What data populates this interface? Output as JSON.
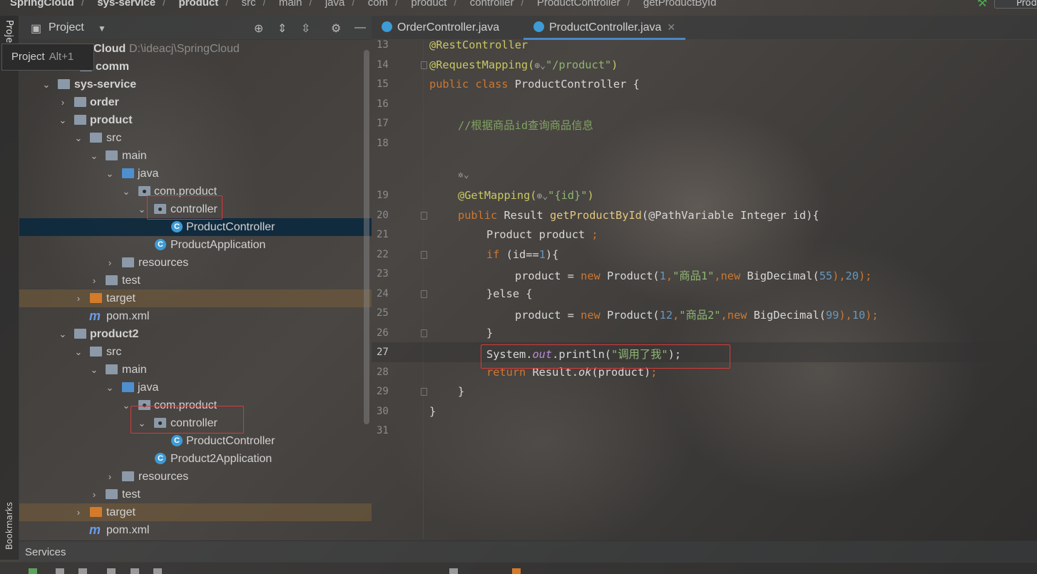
{
  "breadcrumb": [
    "SpringCloud",
    "sys-service",
    "product",
    "src",
    "main",
    "java",
    "com",
    "product",
    "controller",
    "ProductController",
    "getProductById"
  ],
  "top_right": {
    "run_config": "Produ"
  },
  "left_strip": {
    "project_label": "Project",
    "bookmarks_label": "Bookmarks"
  },
  "tooltip": {
    "text": "Project",
    "shortcut": "Alt+1"
  },
  "project_panel": {
    "title": "Project",
    "tree": [
      {
        "label": "Cloud",
        "path": "D:\\ideacj\\SpringCloud"
      },
      {
        "label": "comm"
      },
      {
        "label": "sys-service"
      },
      {
        "label": "order"
      },
      {
        "label": "product"
      },
      {
        "label": "src"
      },
      {
        "label": "main"
      },
      {
        "label": "java"
      },
      {
        "label": "com.product"
      },
      {
        "label": "controller"
      },
      {
        "label": "ProductController"
      },
      {
        "label": "ProductApplication"
      },
      {
        "label": "resources"
      },
      {
        "label": "test"
      },
      {
        "label": "target"
      },
      {
        "label": "pom.xml"
      },
      {
        "label": "product2"
      },
      {
        "label": "src"
      },
      {
        "label": "main"
      },
      {
        "label": "java"
      },
      {
        "label": "com.product"
      },
      {
        "label": "controller"
      },
      {
        "label": "ProductController"
      },
      {
        "label": "Product2Application"
      },
      {
        "label": "resources"
      },
      {
        "label": "test"
      },
      {
        "label": "target"
      },
      {
        "label": "pom.xml"
      }
    ]
  },
  "tabs": [
    {
      "label": "OrderController.java"
    },
    {
      "label": "ProductController.java"
    }
  ],
  "editor": {
    "line_numbers": [
      "13",
      "14",
      "15",
      "16",
      "17",
      "18",
      "19",
      "20",
      "21",
      "22",
      "23",
      "24",
      "25",
      "26",
      "27",
      "28",
      "29",
      "30",
      "31"
    ],
    "current_line": "27",
    "code": {
      "l13": "@RestController",
      "l14a": "@RequestMapping(",
      "l14b": "\"/product\"",
      "l14c": ")",
      "l15a": "public class",
      "l15b": " ProductController {",
      "l17": "//根据商品id查询商品信息",
      "l19a": "@GetMapping(",
      "l19b": "\"{id}\"",
      "l19c": ")",
      "l20a": "public",
      "l20b": " Result ",
      "l20c": "getProductById",
      "l20d": "(@PathVariable Integer id){",
      "l21a": "Product product ",
      "l21b": ";",
      "l22a": "if",
      "l22b": " (id==",
      "l22c": "1",
      "l22d": "){",
      "l23a": "product = ",
      "l23b": "new",
      "l23c": " Product(",
      "l23d": "1",
      "l23e": ",",
      "l23f": "\"商品1\"",
      "l23g": ",",
      "l23h": "new",
      "l23i": " BigDecimal(",
      "l23j": "55",
      "l23k": "),",
      "l23l": "20",
      "l23m": ");",
      "l24a": "}else",
      "l24b": " {",
      "l25a": "product = ",
      "l25b": "new",
      "l25c": " Product(",
      "l25d": "12",
      "l25e": ",",
      "l25f": "\"商品2\"",
      "l25g": ",",
      "l25h": "new",
      "l25i": " BigDecimal(",
      "l25j": "99",
      "l25k": "),",
      "l25l": "10",
      "l25m": ");",
      "l26": "}",
      "l27a": "System.",
      "l27b": "out",
      "l27c": ".println(",
      "l27d": "\"调用了我\"",
      "l27e": ");",
      "l28a": "return",
      "l28b": " Result.",
      "l28c": "ok",
      "l28d": "(product)",
      "l28e": ";",
      "l29": "}",
      "l30": "}"
    }
  },
  "services": {
    "label": "Services"
  },
  "colors": {
    "selection": "#0d293e",
    "highlight_box": "#d83a3a",
    "keyword": "#cc7832",
    "string": "#8fb573",
    "number": "#6897bb",
    "annotation": "#c8c864"
  }
}
